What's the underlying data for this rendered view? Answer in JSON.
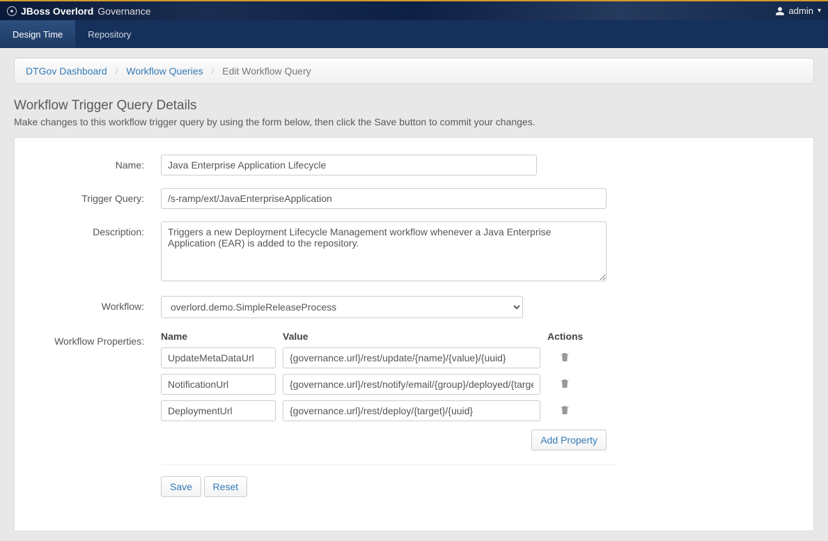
{
  "brand": {
    "strong": "JBoss Overlord",
    "sub": "Governance"
  },
  "user": {
    "name": "admin"
  },
  "nav": {
    "tabs": [
      {
        "label": "Design Time",
        "active": true
      },
      {
        "label": "Repository",
        "active": false
      }
    ]
  },
  "breadcrumb": {
    "items": [
      {
        "label": "DTGov Dashboard",
        "link": true
      },
      {
        "label": "Workflow Queries",
        "link": true
      },
      {
        "label": "Edit Workflow Query",
        "link": false
      }
    ]
  },
  "heading": {
    "title": "Workflow Trigger Query Details",
    "subtitle": "Make changes to this workflow trigger query by using the form below, then click the Save button to commit your changes."
  },
  "form": {
    "name_label": "Name:",
    "name_value": "Java Enterprise Application Lifecycle",
    "trigger_label": "Trigger Query:",
    "trigger_value": "/s-ramp/ext/JavaEnterpriseApplication",
    "description_label": "Description:",
    "description_value": "Triggers a new Deployment Lifecycle Management workflow whenever a Java Enterprise Application (EAR) is added to the repository.",
    "workflow_label": "Workflow:",
    "workflow_value": "overlord.demo.SimpleReleaseProcess",
    "properties_label": "Workflow Properties:",
    "prop_headers": {
      "name": "Name",
      "value": "Value",
      "actions": "Actions"
    },
    "properties": [
      {
        "name": "UpdateMetaDataUrl",
        "value": "{governance.url}/rest/update/{name}/{value}/{uuid}"
      },
      {
        "name": "NotificationUrl",
        "value": "{governance.url}/rest/notify/email/{group}/deployed/{target}/{uuid}"
      },
      {
        "name": "DeploymentUrl",
        "value": "{governance.url}/rest/deploy/{target}/{uuid}"
      }
    ],
    "add_property_label": "Add Property",
    "save_label": "Save",
    "reset_label": "Reset"
  }
}
